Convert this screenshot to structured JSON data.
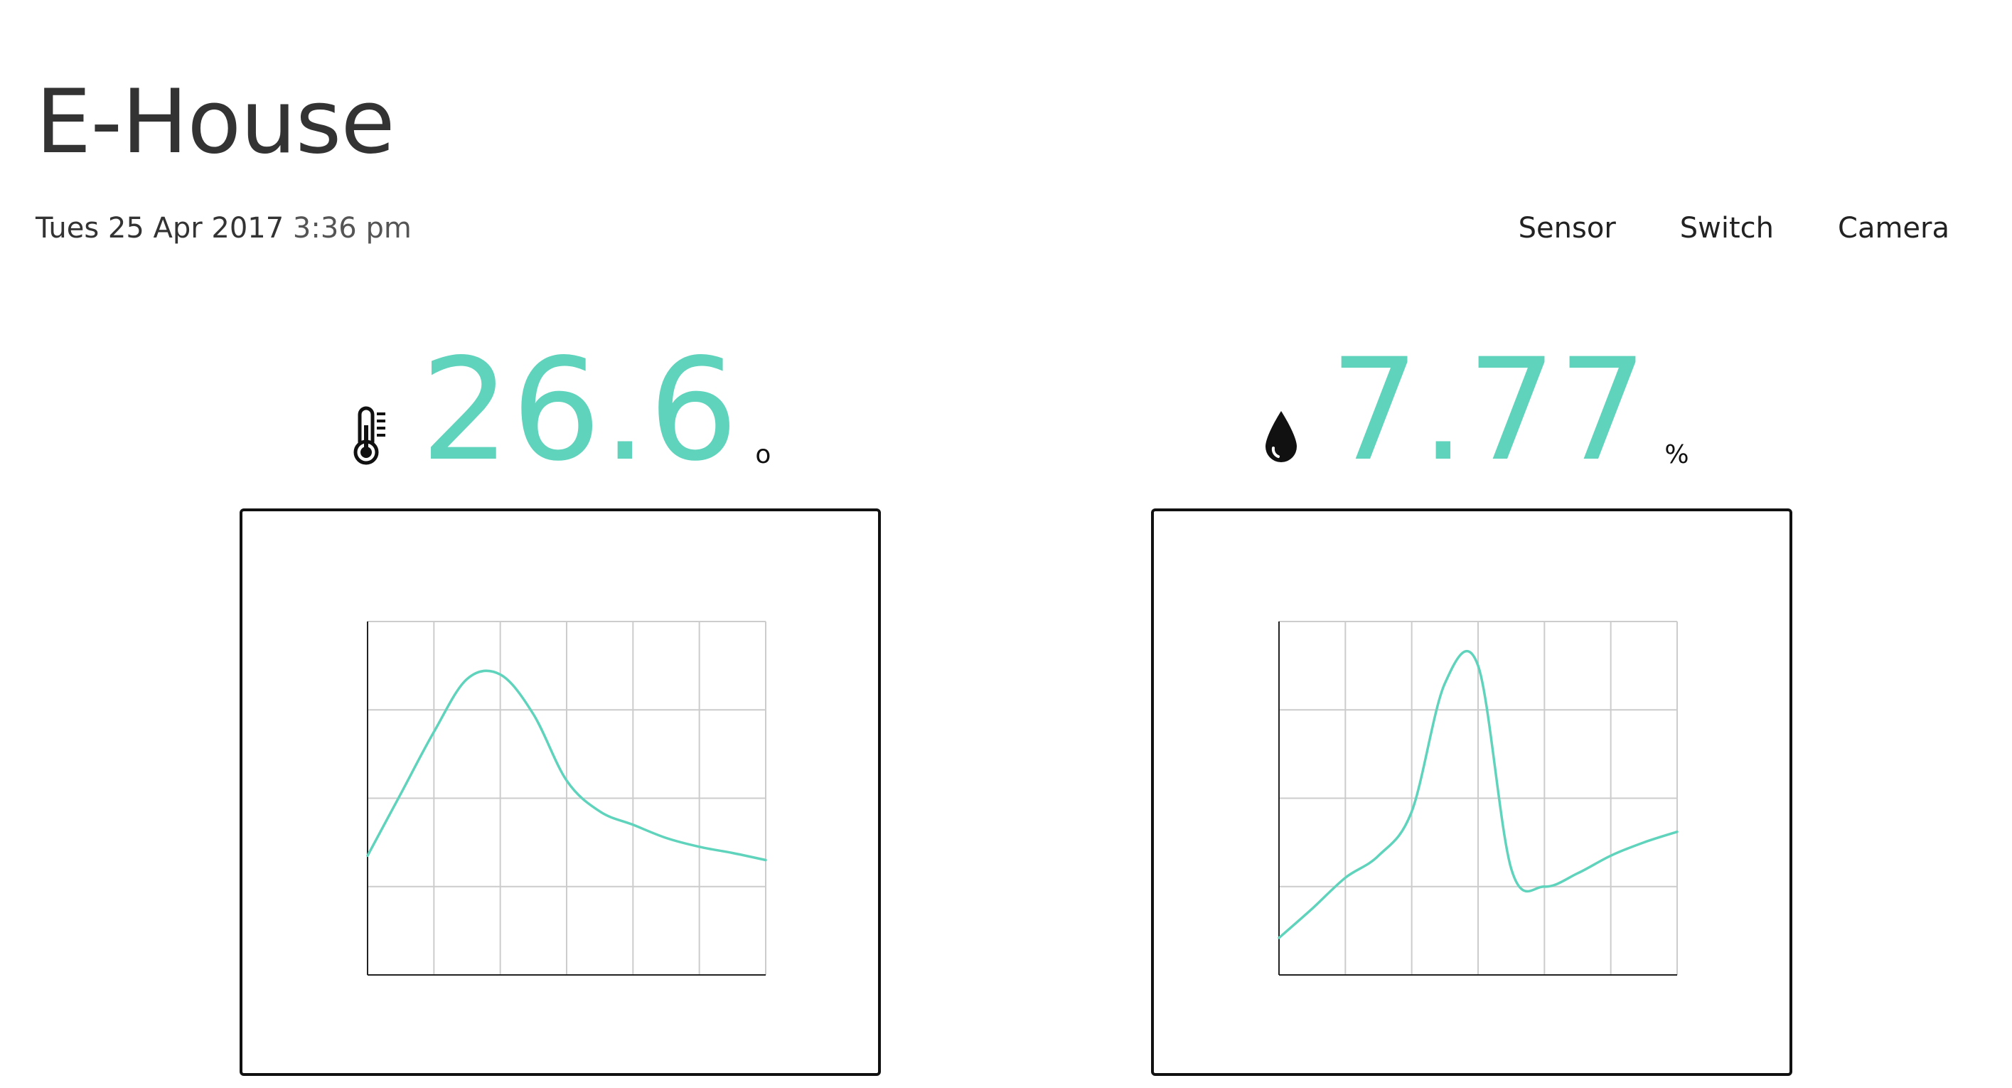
{
  "header": {
    "title": "E-House",
    "date": "Tues 25 Apr 2017",
    "time": "3:36 pm"
  },
  "nav": {
    "items": [
      "Sensor",
      "Switch",
      "Camera"
    ]
  },
  "colors": {
    "accent": "#5fd3bc",
    "text": "#333333",
    "grid": "#cccccc",
    "border": "#111111"
  },
  "readings": {
    "temperature": {
      "icon": "thermometer-icon",
      "value": "26.6",
      "unit": "o"
    },
    "humidity": {
      "icon": "water-drop-icon",
      "value": "7.77",
      "unit": "%"
    }
  },
  "chart_data": [
    {
      "type": "line",
      "title": "",
      "xlabel": "",
      "ylabel": "",
      "grid": true,
      "x": [
        0,
        0.5,
        1,
        1.5,
        2,
        2.5,
        3,
        3.5,
        4,
        4.5,
        5,
        5.5,
        6
      ],
      "ylim": [
        0,
        4
      ],
      "series": [
        {
          "values": [
            1.35,
            2.05,
            2.75,
            3.35,
            3.4,
            2.95,
            2.2,
            1.85,
            1.7,
            1.55,
            1.45,
            1.38,
            1.3
          ]
        }
      ]
    },
    {
      "type": "line",
      "title": "",
      "xlabel": "",
      "ylabel": "",
      "grid": true,
      "x": [
        0,
        0.5,
        1,
        1.5,
        2,
        2.5,
        3,
        3.5,
        4,
        4.5,
        5,
        5.5,
        6
      ],
      "ylim": [
        0,
        4
      ],
      "series": [
        {
          "values": [
            0.42,
            0.75,
            1.1,
            1.35,
            1.85,
            3.3,
            3.5,
            1.2,
            1.0,
            1.15,
            1.35,
            1.5,
            1.62
          ]
        }
      ]
    }
  ]
}
